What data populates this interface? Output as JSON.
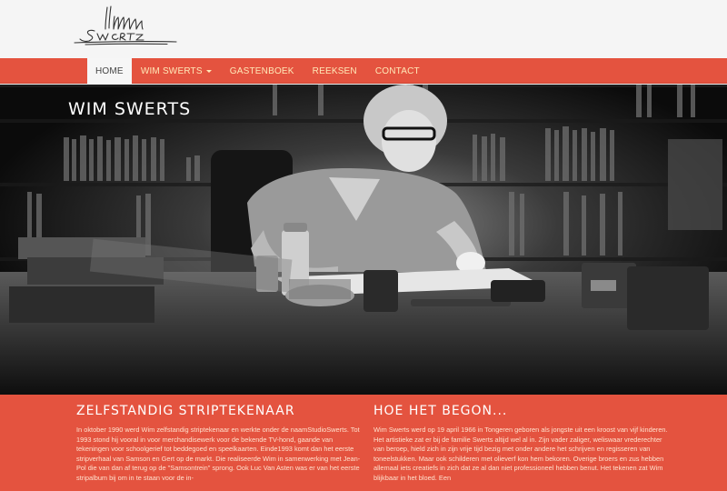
{
  "brand": {
    "logo_alt": "Swerts signature logo",
    "logo_text": "Swerts"
  },
  "nav": {
    "items": [
      {
        "label": "HOME",
        "active": true,
        "has_dropdown": false
      },
      {
        "label": "WIM SWERTS",
        "active": false,
        "has_dropdown": true
      },
      {
        "label": "GASTENBOEK",
        "active": false,
        "has_dropdown": false
      },
      {
        "label": "REEKSEN",
        "active": false,
        "has_dropdown": false
      },
      {
        "label": "CONTACT",
        "active": false,
        "has_dropdown": false
      }
    ]
  },
  "hero": {
    "title": "WIM SWERTS",
    "image_description": "Black-and-white photo of the artist drawing at a desk in front of bookshelves"
  },
  "sections": [
    {
      "heading": "ZELFSTANDIG STRIPTEKENAAR",
      "text": "In oktober 1990 werd Wim zelfstandig striptekenaar en werkte onder de naamStudioSwerts. Tot 1993 stond hij vooral in voor merchandisewerk voor de bekende TV-hond, gaande van tekeningen voor schoolgerief tot beddegoed en speelkaarten. Einde1993 komt dan het eerste stripverhaal van Samson en Gert op de markt. Die realiseerde Wim in samenwerking met Jean-Pol die van dan af terug op de \"Samsontrein\" sprong. Ook Luc Van Asten was er van het eerste stripalbum bij om in te staan voor de in-"
    },
    {
      "heading": "HOE HET BEGON...",
      "text": "Wim Swerts werd op 19 april 1966 in Tongeren geboren als jongste uit een kroost van vijf kinderen. Het artistieke zat er bij de familie Swerts altijd wel al in. Zijn vader zaliger, weliswaar vrederechter van beroep, hield zich in zijn vrije tijd bezig met onder andere het schrijven en regisseren van toneelstukken. Maar ook schilderen met olieverf kon hem bekoren. Overige broers en zus hebben allemaal iets creatiefs in zich dat ze al dan niet professioneel hebben benut. Het tekenen zat Wim blijkbaar in het bloed. Een"
    }
  ],
  "colors": {
    "accent": "#e4533f",
    "nav_text": "#ffe9b8",
    "header_bg": "#f5f5f5"
  }
}
